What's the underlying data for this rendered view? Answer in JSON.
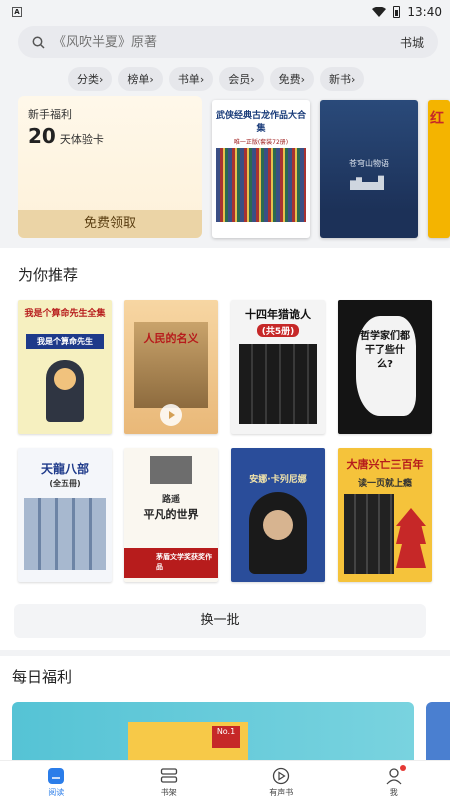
{
  "status_bar": {
    "time": "13:40",
    "notification_glyph": "A"
  },
  "search": {
    "placeholder": "《风吹半夏》原著",
    "bookstore_label": "书城"
  },
  "chips": [
    "分类",
    "榜单",
    "书单",
    "会员",
    "免费",
    "新书"
  ],
  "banner": {
    "newbie_title": "新手福利",
    "trial_days": "20",
    "trial_label": "天体验卡",
    "claim_label": "免费领取",
    "books": [
      {
        "title": "武侠经典古龙作品大合集",
        "subtitle": "唯一正版(套装72册)"
      },
      {
        "title": "苍穹山物语"
      },
      {
        "title": "红"
      }
    ]
  },
  "recommend": {
    "title": "为你推荐",
    "books": [
      {
        "cover_text": "我是个算命先生全集",
        "cover_text2": "我是个算命先生"
      },
      {
        "cover_text": "人民的名义"
      },
      {
        "cover_text": "十四年猎诡人",
        "cover_text2": "(共5册)"
      },
      {
        "cover_text": "哲学家们都干了些什么?"
      },
      {
        "cover_text": "天龍八部",
        "cover_text2": "(全五冊)"
      },
      {
        "cover_text": "平凡的世界",
        "cover_text2": "路遥",
        "cover_text3": "茅盾文学奖获奖作品"
      },
      {
        "cover_text": "安娜·卡列尼娜"
      },
      {
        "cover_text": "大唐兴亡三百年",
        "cover_text2": "读一页就上瘾"
      }
    ],
    "refresh_label": "换一批"
  },
  "daily": {
    "title": "每日福利",
    "promo_badge": "No.1"
  },
  "nav": [
    {
      "label": "阅读",
      "icon": "read-icon",
      "active": true
    },
    {
      "label": "书架",
      "icon": "bookshelf-icon",
      "active": false
    },
    {
      "label": "有声书",
      "icon": "audiobook-icon",
      "active": false
    },
    {
      "label": "我",
      "icon": "profile-icon",
      "active": false
    }
  ],
  "colors": {
    "accent": "#2b7de9",
    "claim": "#ebd4a6",
    "badge": "#e53935"
  }
}
